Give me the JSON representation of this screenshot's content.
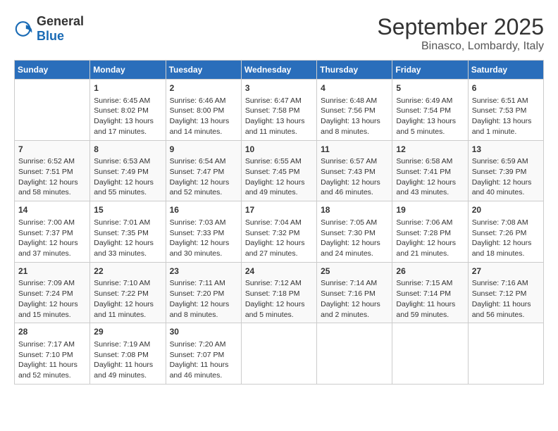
{
  "logo": {
    "general": "General",
    "blue": "Blue"
  },
  "title": "September 2025",
  "location": "Binasco, Lombardy, Italy",
  "weekdays": [
    "Sunday",
    "Monday",
    "Tuesday",
    "Wednesday",
    "Thursday",
    "Friday",
    "Saturday"
  ],
  "weeks": [
    [
      {
        "day": "",
        "info": ""
      },
      {
        "day": "1",
        "info": "Sunrise: 6:45 AM\nSunset: 8:02 PM\nDaylight: 13 hours\nand 17 minutes."
      },
      {
        "day": "2",
        "info": "Sunrise: 6:46 AM\nSunset: 8:00 PM\nDaylight: 13 hours\nand 14 minutes."
      },
      {
        "day": "3",
        "info": "Sunrise: 6:47 AM\nSunset: 7:58 PM\nDaylight: 13 hours\nand 11 minutes."
      },
      {
        "day": "4",
        "info": "Sunrise: 6:48 AM\nSunset: 7:56 PM\nDaylight: 13 hours\nand 8 minutes."
      },
      {
        "day": "5",
        "info": "Sunrise: 6:49 AM\nSunset: 7:54 PM\nDaylight: 13 hours\nand 5 minutes."
      },
      {
        "day": "6",
        "info": "Sunrise: 6:51 AM\nSunset: 7:53 PM\nDaylight: 13 hours\nand 1 minute."
      }
    ],
    [
      {
        "day": "7",
        "info": "Sunrise: 6:52 AM\nSunset: 7:51 PM\nDaylight: 12 hours\nand 58 minutes."
      },
      {
        "day": "8",
        "info": "Sunrise: 6:53 AM\nSunset: 7:49 PM\nDaylight: 12 hours\nand 55 minutes."
      },
      {
        "day": "9",
        "info": "Sunrise: 6:54 AM\nSunset: 7:47 PM\nDaylight: 12 hours\nand 52 minutes."
      },
      {
        "day": "10",
        "info": "Sunrise: 6:55 AM\nSunset: 7:45 PM\nDaylight: 12 hours\nand 49 minutes."
      },
      {
        "day": "11",
        "info": "Sunrise: 6:57 AM\nSunset: 7:43 PM\nDaylight: 12 hours\nand 46 minutes."
      },
      {
        "day": "12",
        "info": "Sunrise: 6:58 AM\nSunset: 7:41 PM\nDaylight: 12 hours\nand 43 minutes."
      },
      {
        "day": "13",
        "info": "Sunrise: 6:59 AM\nSunset: 7:39 PM\nDaylight: 12 hours\nand 40 minutes."
      }
    ],
    [
      {
        "day": "14",
        "info": "Sunrise: 7:00 AM\nSunset: 7:37 PM\nDaylight: 12 hours\nand 37 minutes."
      },
      {
        "day": "15",
        "info": "Sunrise: 7:01 AM\nSunset: 7:35 PM\nDaylight: 12 hours\nand 33 minutes."
      },
      {
        "day": "16",
        "info": "Sunrise: 7:03 AM\nSunset: 7:33 PM\nDaylight: 12 hours\nand 30 minutes."
      },
      {
        "day": "17",
        "info": "Sunrise: 7:04 AM\nSunset: 7:32 PM\nDaylight: 12 hours\nand 27 minutes."
      },
      {
        "day": "18",
        "info": "Sunrise: 7:05 AM\nSunset: 7:30 PM\nDaylight: 12 hours\nand 24 minutes."
      },
      {
        "day": "19",
        "info": "Sunrise: 7:06 AM\nSunset: 7:28 PM\nDaylight: 12 hours\nand 21 minutes."
      },
      {
        "day": "20",
        "info": "Sunrise: 7:08 AM\nSunset: 7:26 PM\nDaylight: 12 hours\nand 18 minutes."
      }
    ],
    [
      {
        "day": "21",
        "info": "Sunrise: 7:09 AM\nSunset: 7:24 PM\nDaylight: 12 hours\nand 15 minutes."
      },
      {
        "day": "22",
        "info": "Sunrise: 7:10 AM\nSunset: 7:22 PM\nDaylight: 12 hours\nand 11 minutes."
      },
      {
        "day": "23",
        "info": "Sunrise: 7:11 AM\nSunset: 7:20 PM\nDaylight: 12 hours\nand 8 minutes."
      },
      {
        "day": "24",
        "info": "Sunrise: 7:12 AM\nSunset: 7:18 PM\nDaylight: 12 hours\nand 5 minutes."
      },
      {
        "day": "25",
        "info": "Sunrise: 7:14 AM\nSunset: 7:16 PM\nDaylight: 12 hours\nand 2 minutes."
      },
      {
        "day": "26",
        "info": "Sunrise: 7:15 AM\nSunset: 7:14 PM\nDaylight: 11 hours\nand 59 minutes."
      },
      {
        "day": "27",
        "info": "Sunrise: 7:16 AM\nSunset: 7:12 PM\nDaylight: 11 hours\nand 56 minutes."
      }
    ],
    [
      {
        "day": "28",
        "info": "Sunrise: 7:17 AM\nSunset: 7:10 PM\nDaylight: 11 hours\nand 52 minutes."
      },
      {
        "day": "29",
        "info": "Sunrise: 7:19 AM\nSunset: 7:08 PM\nDaylight: 11 hours\nand 49 minutes."
      },
      {
        "day": "30",
        "info": "Sunrise: 7:20 AM\nSunset: 7:07 PM\nDaylight: 11 hours\nand 46 minutes."
      },
      {
        "day": "",
        "info": ""
      },
      {
        "day": "",
        "info": ""
      },
      {
        "day": "",
        "info": ""
      },
      {
        "day": "",
        "info": ""
      }
    ]
  ]
}
